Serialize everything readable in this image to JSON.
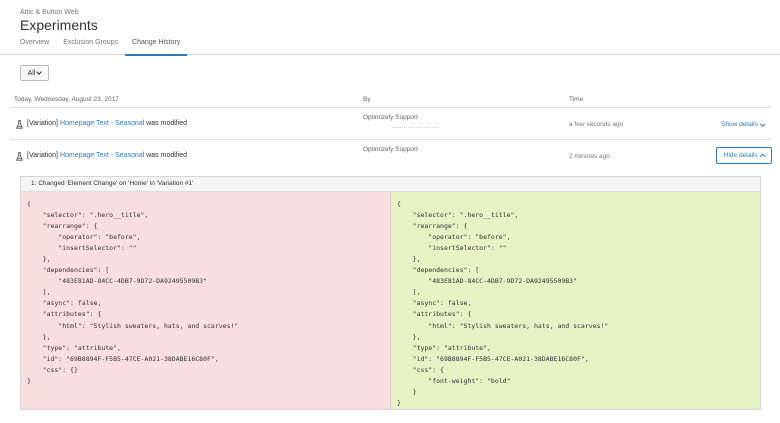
{
  "header": {
    "breadcrumb": "Attic & Button Web",
    "title": "Experiments",
    "tabs": [
      {
        "label": "Overview",
        "active": false
      },
      {
        "label": "Exclusion Groups",
        "active": false
      },
      {
        "label": "Change History",
        "active": true
      }
    ]
  },
  "filter": {
    "label": "All"
  },
  "table": {
    "date_header": "Today, Wednesday, August 23, 2017",
    "by_header": "By",
    "time_header": "Time"
  },
  "rows": [
    {
      "prefix": "[Variation]",
      "link": "Homepage Text - Seasonal",
      "suffix": "was modified",
      "by": "Optimizely Support",
      "time": "a few seconds ago",
      "action": "Show details"
    },
    {
      "prefix": "[Variation]",
      "link": "Homepage Text - Seasonal",
      "suffix": "was modified",
      "by": "Optimizely Support",
      "time": "2 minutes ago",
      "action": "Hide details"
    }
  ],
  "diff": {
    "title": "1: Changed 'Element Change' on 'Home' in 'Variation #1'",
    "before": "{\n    \"selector\": \".hero__title\",\n    \"rearrange\": {\n        \"operator\": \"before\",\n        \"insertSelector\": \"\"\n    },\n    \"dependencies\": [\n        \"483E81AD-84CC-4DB7-9D72-DA92495509B3\"\n    ],\n    \"async\": false,\n    \"attributes\": {\n        \"html\": \"Stylish sweaters, hats, and scarves!\"\n    },\n    \"type\": \"attribute\",\n    \"id\": \"69B8894F-F5B5-47CE-A021-38DABE16C80F\",\n    \"css\": {}\n}",
    "after": "{\n    \"selector\": \".hero__title\",\n    \"rearrange\": {\n        \"operator\": \"before\",\n        \"insertSelector\": \"\"\n    },\n    \"dependencies\": [\n        \"483E81AD-84CC-4DB7-9D72-DA92495509B3\"\n    ],\n    \"async\": false,\n    \"attributes\": {\n        \"html\": \"Stylish sweaters, hats, and scarves!\"\n    },\n    \"type\": \"attribute\",\n    \"id\": \"69B8894F-F5B5-47CE-A021-38DABE16C80F\",\n    \"css\": {\n        \"font-weight\": \"bold\"\n    }\n}",
    "before_color": "#f8dede",
    "after_color": "#e4f2c4"
  },
  "accent_color": "#2b7bbb"
}
